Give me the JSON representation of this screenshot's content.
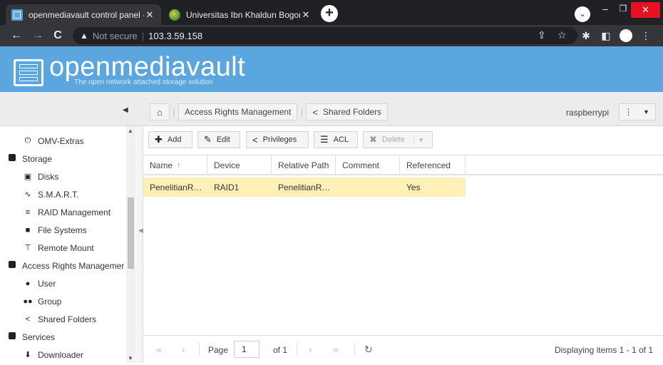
{
  "browser": {
    "tabs": [
      {
        "title": "openmediavault control panel - ",
        "close": "✕",
        "active": true
      },
      {
        "title": "Universitas Ibn Khaldun Bogor",
        "close": "✕",
        "active": false
      }
    ],
    "new_tab": "+",
    "nav": {
      "back": "←",
      "forward": "→",
      "reload": "C"
    },
    "security_warning": "Not secure",
    "url": "103.3.59.158",
    "icons": [
      "share-icon",
      "star-icon",
      "extensions-icon",
      "sidepanel-icon",
      "profile-icon",
      "menu-icon"
    ]
  },
  "app": {
    "logo_text": "openmediavault",
    "logo_subtitle": "The open network attached storage solution",
    "collapse_glyph": "◀"
  },
  "breadcrumb": {
    "home_glyph": "⌂",
    "items": [
      "Access Rights Management",
      "Shared Folders"
    ]
  },
  "host": {
    "name": "raspberrypi",
    "menu_glyph": "⋮",
    "dropdown_glyph": "▼"
  },
  "sidebar": {
    "items": [
      {
        "label": "OMV-Extras",
        "level": 2,
        "icon": "omv-extras-icon"
      },
      {
        "label": "Storage",
        "level": 1,
        "icon": "collapse-icon"
      },
      {
        "label": "Disks",
        "level": 2,
        "icon": "disk-icon"
      },
      {
        "label": "S.M.A.R.T.",
        "level": 2,
        "icon": "heartbeat-icon"
      },
      {
        "label": "RAID Management",
        "level": 2,
        "icon": "database-icon"
      },
      {
        "label": "File Systems",
        "level": 2,
        "icon": "folder-icon"
      },
      {
        "label": "Remote Mount",
        "level": 2,
        "icon": "network-icon"
      },
      {
        "label": "Access Rights Managemer",
        "level": 1,
        "icon": "collapse-icon"
      },
      {
        "label": "User",
        "level": 2,
        "icon": "user-icon"
      },
      {
        "label": "Group",
        "level": 2,
        "icon": "group-icon"
      },
      {
        "label": "Shared Folders",
        "level": 2,
        "icon": "share-icon"
      },
      {
        "label": "Services",
        "level": 1,
        "icon": "collapse-icon"
      },
      {
        "label": "Downloader",
        "level": 2,
        "icon": "download-icon"
      }
    ]
  },
  "toolbar": {
    "add": "Add",
    "edit": "Edit",
    "privileges": "Privileges",
    "acl": "ACL",
    "delete": "Delete",
    "dropdown": "▼"
  },
  "grid": {
    "columns": [
      "Name",
      "Device",
      "Relative Path",
      "Comment",
      "Referenced"
    ],
    "sort_glyph": "↑",
    "rows": [
      {
        "name": "PenelitianR…",
        "device": "RAID1",
        "relative_path": "PenelitianR…",
        "comment": "",
        "referenced": "Yes"
      }
    ]
  },
  "pager": {
    "first": "«",
    "prev": "‹",
    "page_label": "Page",
    "page_value": "1",
    "of_label": "of 1",
    "next": "›",
    "last": "»",
    "refresh": "↻",
    "status": "Displaying items 1 - 1 of 1"
  }
}
